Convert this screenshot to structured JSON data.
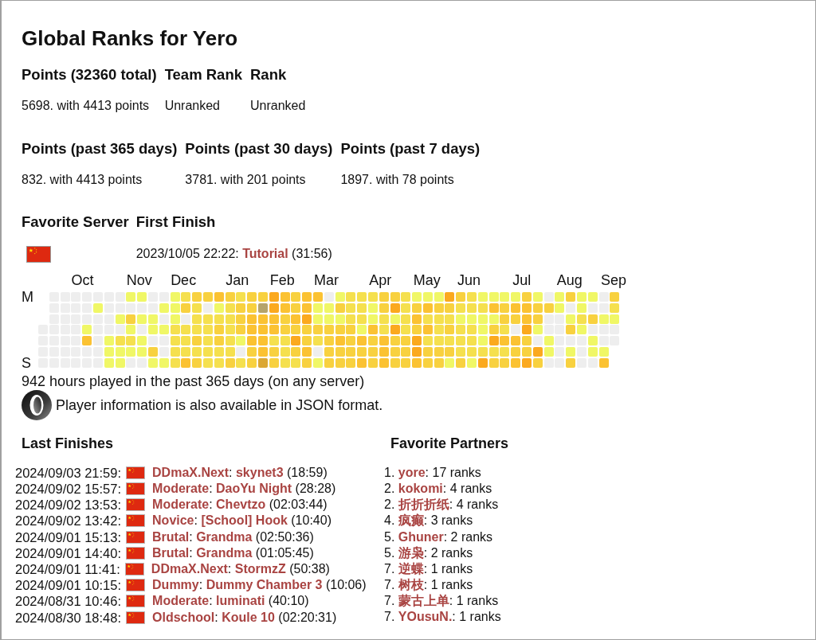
{
  "title": "Global Ranks for Yero",
  "rank_tables": [
    {
      "columns": [
        {
          "heading": "Points (32360 total)",
          "value": "5698. with 4413 points"
        },
        {
          "heading": "Team Rank",
          "value": "Unranked"
        },
        {
          "heading": "Rank",
          "value": "Unranked"
        }
      ]
    },
    {
      "columns": [
        {
          "heading": "Points (past 365 days)",
          "value": "832. with 4413 points"
        },
        {
          "heading": "Points (past 30 days)",
          "value": "3781. with 201 points"
        },
        {
          "heading": "Points (past 7 days)",
          "value": "1897. with 78 points"
        }
      ]
    }
  ],
  "server_table": {
    "favorite_server_heading": "Favorite Server",
    "first_finish_heading": "First Finish",
    "first_finish": {
      "time": "2023/10/05 22:22:",
      "map": "Tutorial",
      "duration": "(31:56)"
    }
  },
  "activity": {
    "first_day_label": "M",
    "last_day_label": "S",
    "weeks": [
      {
        "days": [
          {
            "color": "#eeeeee"
          },
          {
            "color": "#eeeeee"
          },
          {
            "color": "#eeeeee"
          },
          {
            "color": "#eeeeee"
          }
        ]
      },
      {
        "days": [
          {
            "color": "#eeeeee"
          },
          {
            "color": "#eeeeee"
          },
          {
            "color": "#eeeeee"
          },
          {
            "color": "#eeeeee"
          },
          {
            "color": "#eeeeee"
          },
          {
            "color": "#eeeeee"
          },
          {
            "color": "#eeeeee"
          }
        ]
      },
      {
        "days": [
          {
            "color": "#eeeeee"
          },
          {
            "color": "#eeeeee"
          },
          {
            "color": "#eeeeee"
          },
          {
            "color": "#eeeeee"
          },
          {
            "color": "#eeeeee"
          },
          {
            "color": "#eeeeee"
          },
          {
            "color": "#eeeeee"
          }
        ]
      },
      {
        "month": "Oct",
        "days": [
          {
            "color": "#eeeeee"
          },
          {
            "color": "#eeeeee"
          },
          {
            "color": "#eeeeee"
          },
          {
            "color": "#eeeeee"
          },
          {
            "color": "#eeeeee"
          },
          {
            "color": "#eeeeee"
          },
          {
            "color": "#eeeeee"
          }
        ]
      },
      {
        "days": [
          {
            "color": "#eeeeee"
          },
          {
            "color": "#eeeeee"
          },
          {
            "color": "#eeeeee"
          },
          {
            "color": "#f0f766"
          },
          {
            "color": "#fbc232"
          },
          {
            "color": "#eeeeee"
          },
          {
            "color": "#eeeeee"
          }
        ]
      },
      {
        "days": [
          {
            "color": "#eeeeee"
          },
          {
            "color": "#f0f766"
          },
          {
            "color": "#eeeeee"
          },
          {
            "color": "#eeeeee"
          },
          {
            "color": "#eeeeee"
          },
          {
            "color": "#eeeeee"
          },
          {
            "color": "#eeeeee"
          }
        ]
      },
      {
        "days": [
          {
            "color": "#eeeeee"
          },
          {
            "color": "#eeeeee"
          },
          {
            "color": "#eeeeee"
          },
          {
            "color": "#eeeeee"
          },
          {
            "color": "#f0f766"
          },
          {
            "color": "#f0f766"
          },
          {
            "color": "#f0f766"
          }
        ]
      },
      {
        "days": [
          {
            "color": "#eeeeee"
          },
          {
            "color": "#eeeeee"
          },
          {
            "color": "#f0f766"
          },
          {
            "color": "#eeeeee"
          },
          {
            "color": "#f5e04e"
          },
          {
            "color": "#f0f766"
          },
          {
            "color": "#f0f766"
          }
        ]
      },
      {
        "month": "Nov",
        "days": [
          {
            "color": "#f0f766"
          },
          {
            "color": "#eeeeee"
          },
          {
            "color": "#f8d13f"
          },
          {
            "color": "#f0f766"
          },
          {
            "color": "#f5e04e"
          },
          {
            "color": "#f0f766"
          },
          {
            "color": "#eeeeee"
          }
        ]
      },
      {
        "days": [
          {
            "color": "#f0f766"
          },
          {
            "color": "#eeeeee"
          },
          {
            "color": "#f0f766"
          },
          {
            "color": "#eeeeee"
          },
          {
            "color": "#f0f766"
          },
          {
            "color": "#f0f766"
          },
          {
            "color": "#eeeeee"
          }
        ]
      },
      {
        "days": [
          {
            "color": "#eeeeee"
          },
          {
            "color": "#eeeeee"
          },
          {
            "color": "#f0f766"
          },
          {
            "color": "#f0f766"
          },
          {
            "color": "#eeeeee"
          },
          {
            "color": "#f8d13f"
          },
          {
            "color": "#f0f766"
          }
        ]
      },
      {
        "days": [
          {
            "color": "#eeeeee"
          },
          {
            "color": "#f0f766"
          },
          {
            "color": "#eeeeee"
          },
          {
            "color": "#f0f766"
          },
          {
            "color": "#eeeeee"
          },
          {
            "color": "#eeeeee"
          },
          {
            "color": "#f0f766"
          }
        ]
      },
      {
        "month": "Dec",
        "days": [
          {
            "color": "#f0f766"
          },
          {
            "color": "#f0f766"
          },
          {
            "color": "#f0f766"
          },
          {
            "color": "#f5e04e"
          },
          {
            "color": "#f5e04e"
          },
          {
            "color": "#f5e04e"
          },
          {
            "color": "#f5e04e"
          }
        ]
      },
      {
        "days": [
          {
            "color": "#f5e04e"
          },
          {
            "color": "#f8d13f"
          },
          {
            "color": "#eeeeee"
          },
          {
            "color": "#f5e04e"
          },
          {
            "color": "#f5e04e"
          },
          {
            "color": "#f5e04e"
          },
          {
            "color": "#fbc232"
          }
        ]
      },
      {
        "days": [
          {
            "color": "#f8d13f"
          },
          {
            "color": "#f5e04e"
          },
          {
            "color": "#f5e04e"
          },
          {
            "color": "#f5e04e"
          },
          {
            "color": "#f8d13f"
          },
          {
            "color": "#f5e04e"
          },
          {
            "color": "#f8d13f"
          }
        ]
      },
      {
        "days": [
          {
            "color": "#f8d13f"
          },
          {
            "color": "#eeeeee"
          },
          {
            "color": "#f5e04e"
          },
          {
            "color": "#f5e04e"
          },
          {
            "color": "#f5e04e"
          },
          {
            "color": "#f5e04e"
          },
          {
            "color": "#f5e04e"
          }
        ]
      },
      {
        "days": [
          {
            "color": "#fbc232"
          },
          {
            "color": "#f0f766"
          },
          {
            "color": "#f5e04e"
          },
          {
            "color": "#f8d13f"
          },
          {
            "color": "#f8d13f"
          },
          {
            "color": "#f5e04e"
          },
          {
            "color": "#f5e04e"
          }
        ]
      },
      {
        "month": "Jan",
        "days": [
          {
            "color": "#f8d13f"
          },
          {
            "color": "#f5e04e"
          },
          {
            "color": "#f5e04e"
          },
          {
            "color": "#f5e04e"
          },
          {
            "color": "#f5e04e"
          },
          {
            "color": "#f5e04e"
          },
          {
            "color": "#f8d13f"
          }
        ]
      },
      {
        "days": [
          {
            "color": "#f5e04e"
          },
          {
            "color": "#f8d13f"
          },
          {
            "color": "#f8d13f"
          },
          {
            "color": "#f8d13f"
          },
          {
            "color": "#f0f766"
          },
          {
            "color": "#eeeeee"
          },
          {
            "color": "#f5e04e"
          }
        ]
      },
      {
        "days": [
          {
            "color": "#f8d13f"
          },
          {
            "color": "#f8d13f"
          },
          {
            "color": "#fbc232"
          },
          {
            "color": "#fbc232"
          },
          {
            "color": "#fbc232"
          },
          {
            "color": "#f8d13f"
          },
          {
            "color": "#f8d13f"
          }
        ]
      },
      {
        "days": [
          {
            "color": "#f8d13f"
          },
          {
            "color": "#b5a46b"
          },
          {
            "color": "#fbc232"
          },
          {
            "color": "#fbc232"
          },
          {
            "color": "#fbc232"
          },
          {
            "color": "#fbc232"
          },
          {
            "color": "#dba733"
          }
        ]
      },
      {
        "month": "Feb",
        "days": [
          {
            "color": "#fba91e"
          },
          {
            "color": "#fba91e"
          },
          {
            "color": "#fbc232"
          },
          {
            "color": "#fbc232"
          },
          {
            "color": "#f5e04e"
          },
          {
            "color": "#f8d13f"
          },
          {
            "color": "#f8d13f"
          }
        ]
      },
      {
        "days": [
          {
            "color": "#fbc232"
          },
          {
            "color": "#fbc232"
          },
          {
            "color": "#f8d13f"
          },
          {
            "color": "#f8d13f"
          },
          {
            "color": "#f5e04e"
          },
          {
            "color": "#f5e04e"
          },
          {
            "color": "#f5e04e"
          }
        ]
      },
      {
        "days": [
          {
            "color": "#f8d13f"
          },
          {
            "color": "#f8d13f"
          },
          {
            "color": "#fbc232"
          },
          {
            "color": "#f8d13f"
          },
          {
            "color": "#fba91e"
          },
          {
            "color": "#f8d13f"
          },
          {
            "color": "#f5e04e"
          }
        ]
      },
      {
        "days": [
          {
            "color": "#fbc232"
          },
          {
            "color": "#fbc232"
          },
          {
            "color": "#fba91e"
          },
          {
            "color": "#f8d13f"
          },
          {
            "color": "#f8d13f"
          },
          {
            "color": "#fbc232"
          },
          {
            "color": "#f8d13f"
          }
        ]
      },
      {
        "month": "Mar",
        "days": [
          {
            "color": "#fbc232"
          },
          {
            "color": "#f0f766"
          },
          {
            "color": "#f0f766"
          },
          {
            "color": "#f8d13f"
          },
          {
            "color": "#f5e04e"
          },
          {
            "color": "#eeeeee"
          },
          {
            "color": "#f0f766"
          }
        ]
      },
      {
        "days": [
          {
            "color": "#eeeeee"
          },
          {
            "color": "#f0f766"
          },
          {
            "color": "#f0f766"
          },
          {
            "color": "#f8d13f"
          },
          {
            "color": "#f8d13f"
          },
          {
            "color": "#f8d13f"
          },
          {
            "color": "#f8d13f"
          }
        ]
      },
      {
        "days": [
          {
            "color": "#f0f766"
          },
          {
            "color": "#f8d13f"
          },
          {
            "color": "#f0f766"
          },
          {
            "color": "#f8d13f"
          },
          {
            "color": "#fbc232"
          },
          {
            "color": "#f8d13f"
          },
          {
            "color": "#f8d13f"
          }
        ]
      },
      {
        "days": [
          {
            "color": "#f5e04e"
          },
          {
            "color": "#f5e04e"
          },
          {
            "color": "#f5e04e"
          },
          {
            "color": "#f8d13f"
          },
          {
            "color": "#f8d13f"
          },
          {
            "color": "#f8d13f"
          },
          {
            "color": "#f8d13f"
          }
        ]
      },
      {
        "days": [
          {
            "color": "#f5e04e"
          },
          {
            "color": "#f5e04e"
          },
          {
            "color": "#f5e04e"
          },
          {
            "color": "#f0f766"
          },
          {
            "color": "#fbc232"
          },
          {
            "color": "#f8d13f"
          },
          {
            "color": "#fbc232"
          }
        ]
      },
      {
        "month": "Apr",
        "days": [
          {
            "color": "#f5e04e"
          },
          {
            "color": "#f0f766"
          },
          {
            "color": "#f0f766"
          },
          {
            "color": "#fbc232"
          },
          {
            "color": "#f8d13f"
          },
          {
            "color": "#f8d13f"
          },
          {
            "color": "#f8d13f"
          }
        ]
      },
      {
        "days": [
          {
            "color": "#f8d13f"
          },
          {
            "color": "#f8d13f"
          },
          {
            "color": "#f5e04e"
          },
          {
            "color": "#f5e04e"
          },
          {
            "color": "#fbc232"
          },
          {
            "color": "#fbc232"
          },
          {
            "color": "#fbc232"
          }
        ]
      },
      {
        "days": [
          {
            "color": "#f8d13f"
          },
          {
            "color": "#fba91e"
          },
          {
            "color": "#f0f766"
          },
          {
            "color": "#fba91e"
          },
          {
            "color": "#f8d13f"
          },
          {
            "color": "#f8d13f"
          },
          {
            "color": "#f8d13f"
          }
        ]
      },
      {
        "days": [
          {
            "color": "#f5e04e"
          },
          {
            "color": "#f5e04e"
          },
          {
            "color": "#f5e04e"
          },
          {
            "color": "#f5e04e"
          },
          {
            "color": "#f8d13f"
          },
          {
            "color": "#f8d13f"
          },
          {
            "color": "#f8d13f"
          }
        ]
      },
      {
        "month": "May",
        "days": [
          {
            "color": "#f0f766"
          },
          {
            "color": "#f8d13f"
          },
          {
            "color": "#fbc232"
          },
          {
            "color": "#f8d13f"
          },
          {
            "color": "#fba91e"
          },
          {
            "color": "#fba91e"
          },
          {
            "color": "#fbc232"
          }
        ]
      },
      {
        "days": [
          {
            "color": "#f0f766"
          },
          {
            "color": "#fbc232"
          },
          {
            "color": "#f5e04e"
          },
          {
            "color": "#fbc232"
          },
          {
            "color": "#f5e04e"
          },
          {
            "color": "#f8d13f"
          },
          {
            "color": "#f8d13f"
          }
        ]
      },
      {
        "days": [
          {
            "color": "#f0f766"
          },
          {
            "color": "#f8d13f"
          },
          {
            "color": "#f5e04e"
          },
          {
            "color": "#f5e04e"
          },
          {
            "color": "#f5e04e"
          },
          {
            "color": "#f8d13f"
          },
          {
            "color": "#f8d13f"
          }
        ]
      },
      {
        "days": [
          {
            "color": "#fba91e"
          },
          {
            "color": "#f8d13f"
          },
          {
            "color": "#f5e04e"
          },
          {
            "color": "#f8d13f"
          },
          {
            "color": "#f5e04e"
          },
          {
            "color": "#f8d13f"
          },
          {
            "color": "#f0f766"
          }
        ]
      },
      {
        "month": "Jun",
        "days": [
          {
            "color": "#f8d13f"
          },
          {
            "color": "#f5e04e"
          },
          {
            "color": "#f0f766"
          },
          {
            "color": "#f5e04e"
          },
          {
            "color": "#f5e04e"
          },
          {
            "color": "#f5e04e"
          },
          {
            "color": "#f8d13f"
          }
        ]
      },
      {
        "days": [
          {
            "color": "#f5e04e"
          },
          {
            "color": "#f5e04e"
          },
          {
            "color": "#f0f766"
          },
          {
            "color": "#f5e04e"
          },
          {
            "color": "#f5e04e"
          },
          {
            "color": "#f5e04e"
          },
          {
            "color": "#f0f766"
          }
        ]
      },
      {
        "days": [
          {
            "color": "#f0f766"
          },
          {
            "color": "#f5e04e"
          },
          {
            "color": "#f0f766"
          },
          {
            "color": "#f0f766"
          },
          {
            "color": "#f0f766"
          },
          {
            "color": "#f5e04e"
          },
          {
            "color": "#fba91e"
          }
        ]
      },
      {
        "days": [
          {
            "color": "#f0f766"
          },
          {
            "color": "#fbc232"
          },
          {
            "color": "#f0f766"
          },
          {
            "color": "#f8d13f"
          },
          {
            "color": "#fba91e"
          },
          {
            "color": "#f5e04e"
          },
          {
            "color": "#f8d13f"
          }
        ]
      },
      {
        "days": [
          {
            "color": "#f0f766"
          },
          {
            "color": "#f8d13f"
          },
          {
            "color": "#f8d13f"
          },
          {
            "color": "#f5e04e"
          },
          {
            "color": "#fbc232"
          },
          {
            "color": "#f5e04e"
          },
          {
            "color": "#f8d13f"
          }
        ]
      },
      {
        "month": "Jul",
        "days": [
          {
            "color": "#f0f766"
          },
          {
            "color": "#fbc232"
          },
          {
            "color": "#f8d13f"
          },
          {
            "color": "#eeeeee"
          },
          {
            "color": "#fbc232"
          },
          {
            "color": "#f8d13f"
          },
          {
            "color": "#fbc232"
          }
        ]
      },
      {
        "days": [
          {
            "color": "#f8d13f"
          },
          {
            "color": "#fbc232"
          },
          {
            "color": "#fbc232"
          },
          {
            "color": "#fba91e"
          },
          {
            "color": "#f8d13f"
          },
          {
            "color": "#f8d13f"
          },
          {
            "color": "#fba91e"
          }
        ]
      },
      {
        "days": [
          {
            "color": "#f0f766"
          },
          {
            "color": "#f8d13f"
          },
          {
            "color": "#f8d13f"
          },
          {
            "color": "#f0f766"
          },
          {
            "color": "#eeeeee"
          },
          {
            "color": "#fba91e"
          },
          {
            "color": "#f8d13f"
          }
        ]
      },
      {
        "days": [
          {
            "color": "#eeeeee"
          },
          {
            "color": "#f8d13f"
          },
          {
            "color": "#eeeeee"
          },
          {
            "color": "#eeeeee"
          },
          {
            "color": "#f0f766"
          },
          {
            "color": "#f0f766"
          },
          {
            "color": "#eeeeee"
          }
        ]
      },
      {
        "month": "Aug",
        "days": [
          {
            "color": "#f0f766"
          },
          {
            "color": "#f0f766"
          },
          {
            "color": "#eeeeee"
          },
          {
            "color": "#eeeeee"
          },
          {
            "color": "#eeeeee"
          },
          {
            "color": "#eeeeee"
          },
          {
            "color": "#eeeeee"
          }
        ]
      },
      {
        "days": [
          {
            "color": "#f8d13f"
          },
          {
            "color": "#eeeeee"
          },
          {
            "color": "#f0f766"
          },
          {
            "color": "#f8d13f"
          },
          {
            "color": "#eeeeee"
          },
          {
            "color": "#f0f766"
          },
          {
            "color": "#f8d13f"
          }
        ]
      },
      {
        "days": [
          {
            "color": "#f0f766"
          },
          {
            "color": "#f0f766"
          },
          {
            "color": "#f5e04e"
          },
          {
            "color": "#f0f766"
          },
          {
            "color": "#eeeeee"
          },
          {
            "color": "#eeeeee"
          },
          {
            "color": "#eeeeee"
          }
        ]
      },
      {
        "days": [
          {
            "color": "#f0f766"
          },
          {
            "color": "#eeeeee"
          },
          {
            "color": "#f8d13f"
          },
          {
            "color": "#eeeeee"
          },
          {
            "color": "#f0f766"
          },
          {
            "color": "#f0f766"
          },
          {
            "color": "#eeeeee"
          }
        ]
      },
      {
        "month": "Sep",
        "days": [
          {
            "color": "#eeeeee"
          },
          {
            "color": "#eeeeee"
          },
          {
            "color": "#f0f766"
          },
          {
            "color": "#eeeeee"
          },
          {
            "color": "#eeeeee"
          },
          {
            "color": "#f0f766"
          },
          {
            "color": "#fbc232"
          }
        ]
      },
      {
        "days": [
          {
            "color": "#f8d13f"
          },
          {
            "color": "#f5e04e"
          },
          {
            "color": "#f0f766"
          },
          {
            "color": "#eeeeee"
          },
          {
            "color": "#eeeeee"
          }
        ]
      }
    ]
  },
  "hours_played": "942 hours played in the past 365 days (on any server)",
  "json_note": "Player information is also available in JSON format.",
  "last_finishes": {
    "heading": "Last Finishes",
    "items": [
      {
        "time": "2024/09/03 21:59:",
        "category": "DDmaX.Next",
        "separator": ":",
        "map": "skynet3",
        "duration": "(18:59)"
      },
      {
        "time": "2024/09/02 15:57:",
        "category": "Moderate",
        "separator": ":",
        "map": "DaoYu Night",
        "duration": "(28:28)"
      },
      {
        "time": "2024/09/02 13:53:",
        "category": "Moderate",
        "separator": ":",
        "map": "Chevtzo",
        "duration": "(02:03:44)"
      },
      {
        "time": "2024/09/02 13:42:",
        "category": "Novice",
        "separator": ":",
        "map": "[School] Hook",
        "duration": "(10:40)"
      },
      {
        "time": "2024/09/01 15:13:",
        "category": "Brutal",
        "separator": ":",
        "map": "Grandma",
        "duration": "(02:50:36)"
      },
      {
        "time": "2024/09/01 14:40:",
        "category": "Brutal",
        "separator": ":",
        "map": "Grandma",
        "duration": "(01:05:45)"
      },
      {
        "time": "2024/09/01 11:41:",
        "category": "DDmaX.Next",
        "separator": ":",
        "map": "StormzZ",
        "duration": "(50:38)"
      },
      {
        "time": "2024/09/01 10:15:",
        "category": "Dummy",
        "separator": ":",
        "map": "Dummy Chamber 3",
        "duration": "(10:06)"
      },
      {
        "time": "2024/08/31 10:46:",
        "category": "Moderate",
        "separator": ":",
        "map": "luminati",
        "duration": "(40:10)"
      },
      {
        "time": "2024/08/30 18:48:",
        "category": "Oldschool",
        "separator": ":",
        "map": "Koule 10",
        "duration": "(02:20:31)"
      }
    ]
  },
  "favorite_partners": {
    "heading": "Favorite Partners",
    "items": [
      {
        "place": "1.",
        "name": "yore",
        "count": ": 17 ranks"
      },
      {
        "place": "2.",
        "name": "kokomi",
        "count": ": 4 ranks"
      },
      {
        "place": "2.",
        "name": "折折折纸",
        "count": ": 4 ranks"
      },
      {
        "place": "4.",
        "name": "疯癫",
        "count": ": 3 ranks"
      },
      {
        "place": "5.",
        "name": "Ghuner",
        "count": ": 2 ranks"
      },
      {
        "place": "5.",
        "name": "游枭",
        "count": ": 2 ranks"
      },
      {
        "place": "7.",
        "name": "逆蝶",
        "count": ": 1 ranks"
      },
      {
        "place": "7.",
        "name": "树枝",
        "count": ": 1 ranks"
      },
      {
        "place": "7.",
        "name": "蒙古上单",
        "count": ": 1 ranks"
      },
      {
        "place": "7.",
        "name": "YOusuN.",
        "count": ": 1 ranks"
      }
    ]
  }
}
